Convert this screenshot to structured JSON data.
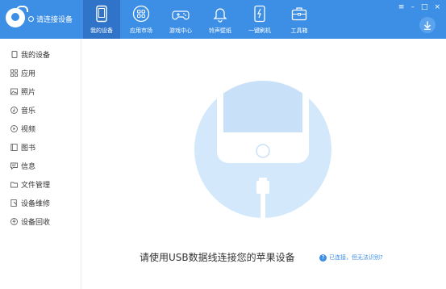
{
  "header": {
    "connect_label": "请连接设备",
    "nav": [
      {
        "label": "我的设备",
        "icon": "phone-icon",
        "active": true
      },
      {
        "label": "应用市场",
        "icon": "apps-icon",
        "active": false
      },
      {
        "label": "游戏中心",
        "icon": "gamepad-icon",
        "active": false
      },
      {
        "label": "铃声壁纸",
        "icon": "bell-icon",
        "active": false
      },
      {
        "label": "一键刷机",
        "icon": "flash-icon",
        "active": false
      },
      {
        "label": "工具箱",
        "icon": "toolbox-icon",
        "active": false
      }
    ],
    "window_controls": [
      "≡",
      "–",
      "□",
      "×"
    ]
  },
  "sidebar": {
    "items": [
      {
        "label": "我的设备",
        "icon": "device-icon"
      },
      {
        "label": "应用",
        "icon": "apps-icon"
      },
      {
        "label": "照片",
        "icon": "photo-icon"
      },
      {
        "label": "音乐",
        "icon": "music-icon"
      },
      {
        "label": "视频",
        "icon": "video-icon"
      },
      {
        "label": "图书",
        "icon": "book-icon"
      },
      {
        "label": "信息",
        "icon": "message-icon"
      },
      {
        "label": "文件管理",
        "icon": "folder-icon"
      },
      {
        "label": "设备维修",
        "icon": "repair-icon"
      },
      {
        "label": "设备回收",
        "icon": "recycle-icon"
      }
    ]
  },
  "main": {
    "tip": "请使用USB数据线连接您的苹果设备",
    "help_label": "已连接，但无法识别?",
    "help_icon": "question-icon"
  },
  "colors": {
    "header_bg": "#3d8fe6",
    "nav_active_bg": "#2f74c9",
    "illustration_circle": "#d3e8fb",
    "link": "#3d8fe6"
  }
}
